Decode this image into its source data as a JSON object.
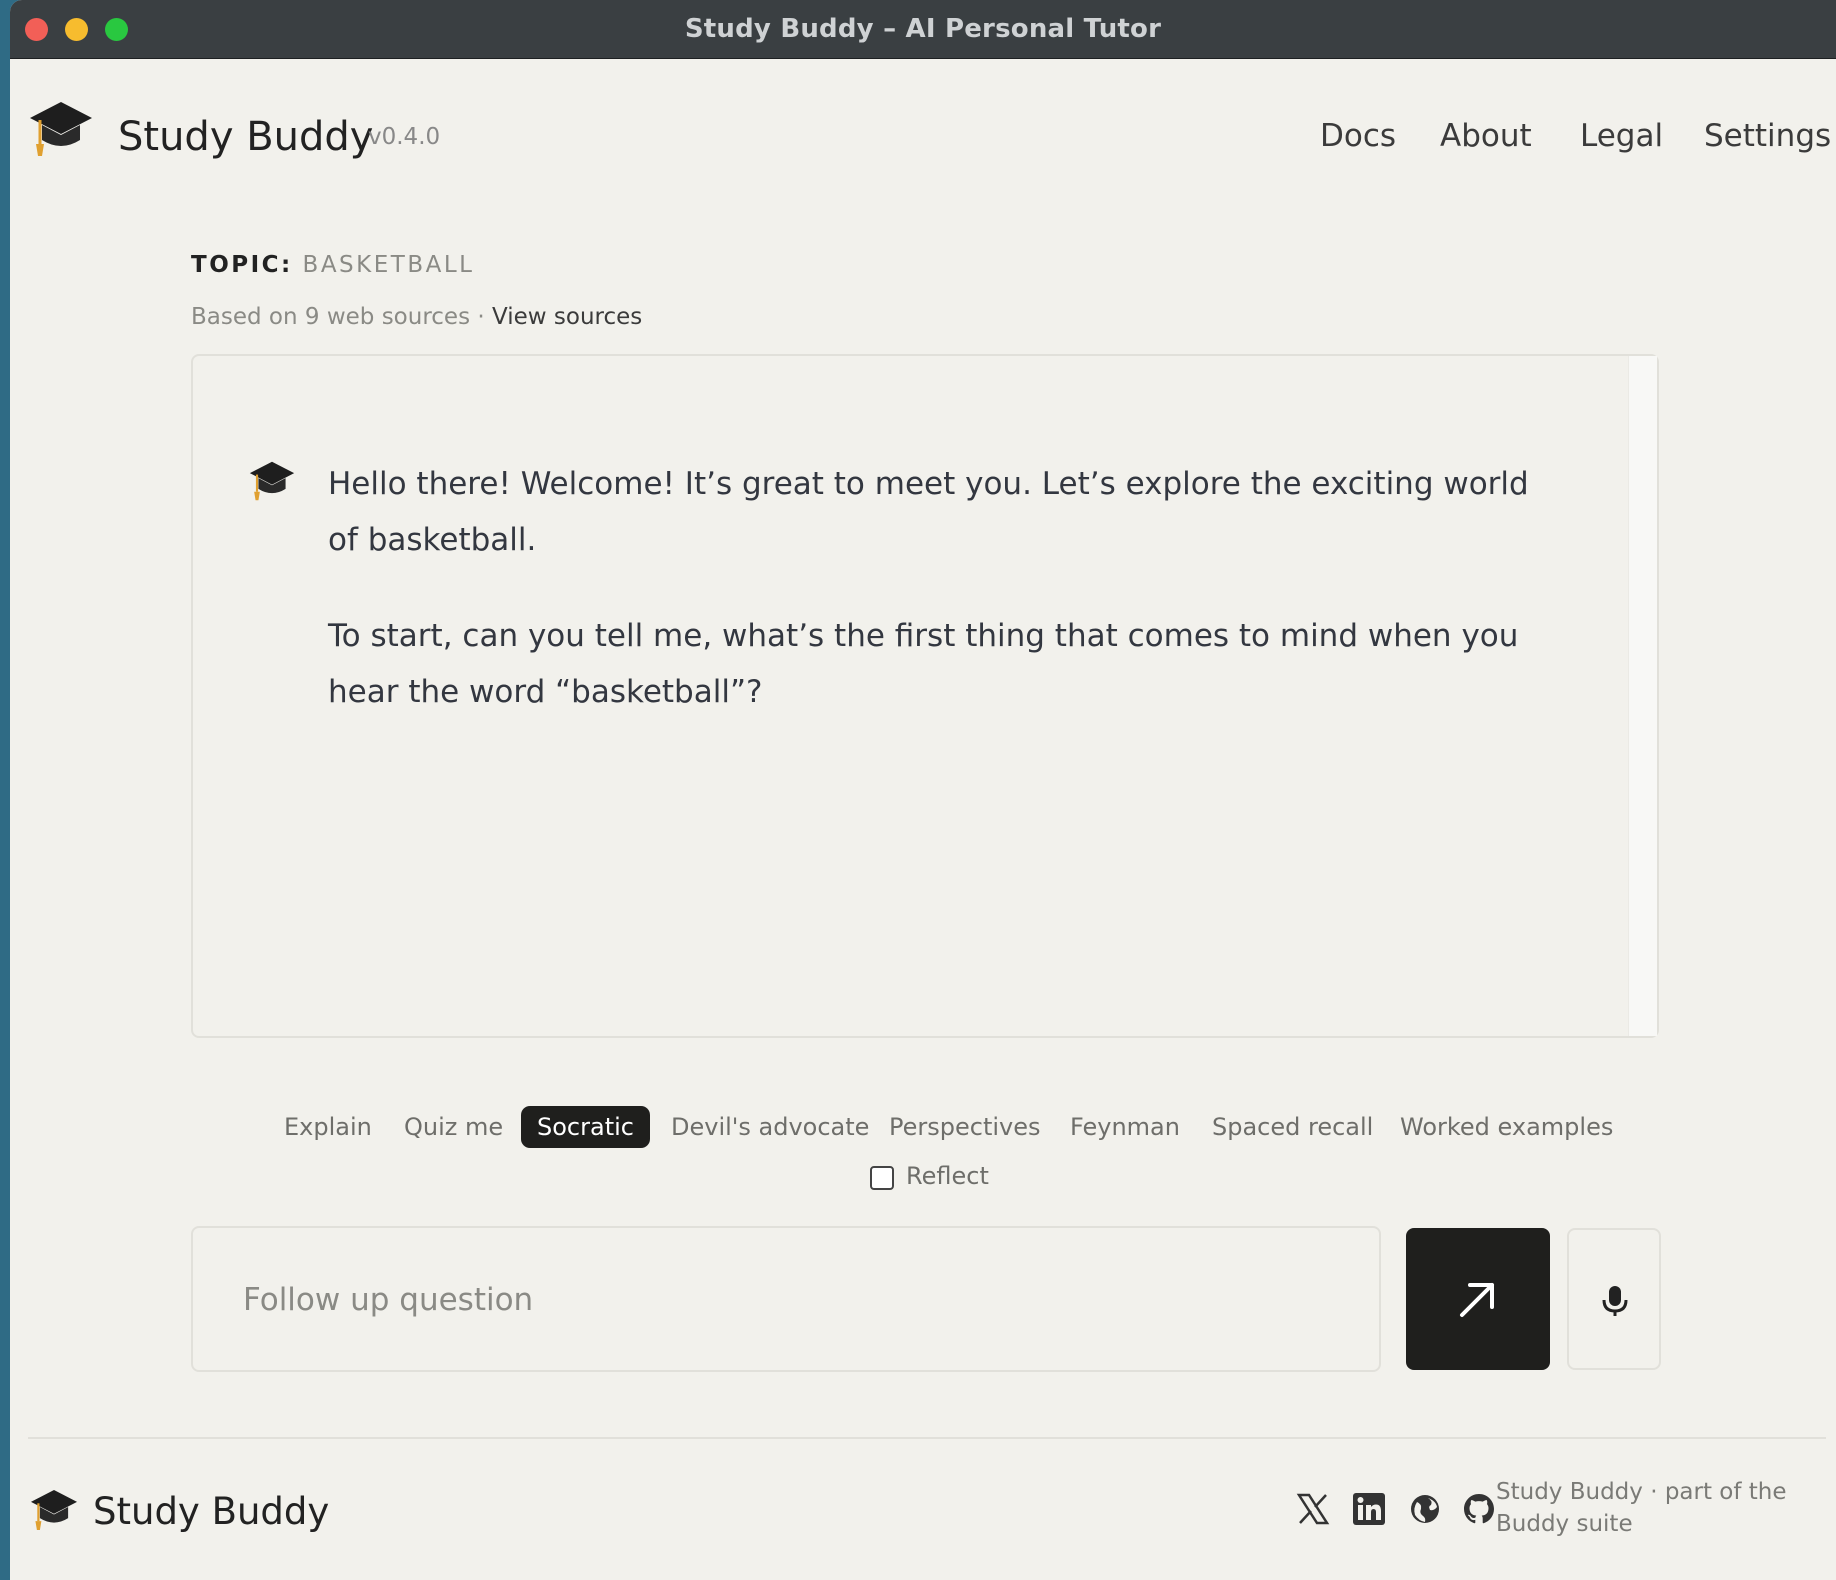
{
  "window": {
    "title": "Study Buddy – AI Personal Tutor"
  },
  "header": {
    "app_name": "Study Buddy",
    "version": "v0.4.0",
    "nav": [
      "Docs",
      "About",
      "Legal",
      "Settings"
    ]
  },
  "topic": {
    "label": "TOPIC:",
    "value": "BASKETBALL",
    "sources_text": "Based on 9 web sources",
    "separator": "·",
    "view_sources": "View sources"
  },
  "chat": {
    "messages": [
      {
        "role": "assistant",
        "paragraphs": [
          "Hello there! Welcome! It’s great to meet you. Let’s explore the exciting world of basketball.",
          "To start, can you tell me, what’s the first thing that comes to mind when you hear the word “basketball”?"
        ]
      }
    ]
  },
  "modes": {
    "items": [
      "Explain",
      "Quiz me",
      "Socratic",
      "Devil's advocate",
      "Perspectives",
      "Feynman",
      "Spaced recall",
      "Worked examples"
    ],
    "active": "Socratic",
    "reflect_label": "Reflect",
    "reflect_checked": false
  },
  "input": {
    "placeholder": "Follow up question",
    "value": ""
  },
  "buttons": {
    "send_icon": "arrow-up-right-icon",
    "mic_icon": "microphone-icon"
  },
  "footer": {
    "brand": "Study Buddy",
    "social_icons": [
      "x-icon",
      "linkedin-icon",
      "globe-icon",
      "github-icon"
    ],
    "text": "Study Buddy · part of the Buddy suite"
  },
  "colors": {
    "accent": "#1f1f1d",
    "background": "#f2f1ec",
    "tassel": "#e0a030"
  }
}
